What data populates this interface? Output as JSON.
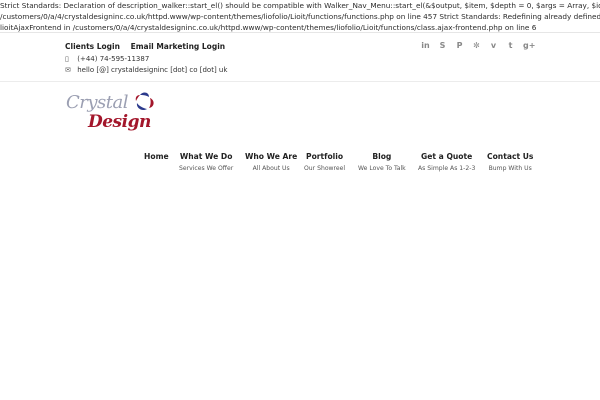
{
  "notice": {
    "lines": [
      "Strict Standards: Declaration of description_walker::start_el() should be compatible with Walker_Nav_Menu::start_el(&$output, $item, $depth = 0, $args = Array, $id = 0) in",
      "/customers/0/a/4/crystaldesigninc.co.uk/httpd.www/wp-content/themes/liofolio/Lioit/functions/functions.php on line 457 Strict Standards: Redefining already defined constructor for class",
      "lioitAjaxFrontend in /customers/0/a/4/crystaldesigninc.co.uk/httpd.www/wp-content/themes/liofolio/Lioit/functions/class.ajax-frontend.php on line 6"
    ]
  },
  "topbar": {
    "clients_login": "Clients Login",
    "email_marketing_login": "Email Marketing Login",
    "phone": "(+44) 74-595-11387",
    "email": "hello [@] crystaldesigninc [dot] co [dot] uk",
    "phone_icon": "phone-icon",
    "email_icon": "envelope-icon",
    "social_icons": [
      "linkedin-icon",
      "skype-icon",
      "pinterest-icon",
      "dribbble-icon",
      "vimeo-icon",
      "twitter-icon",
      "google-plus-icon"
    ]
  },
  "logo": {
    "line1": "Crystal",
    "line2": "Design",
    "colors": {
      "grey": "#9b9fb2",
      "red": "#a3162b",
      "navy": "#2b3a8c"
    }
  },
  "nav": {
    "items": [
      {
        "label": "Home",
        "sub": ""
      },
      {
        "label": "What We Do",
        "sub": "Services We Offer"
      },
      {
        "label": "Who We Are",
        "sub": "All About Us"
      },
      {
        "label": "Portfolio",
        "sub": "Our Showreel"
      },
      {
        "label": "Blog",
        "sub": "We Love To Talk"
      },
      {
        "label": "Get a Quote",
        "sub": "As Simple As 1-2-3"
      },
      {
        "label": "Contact Us",
        "sub": "Bump With Us"
      }
    ]
  }
}
